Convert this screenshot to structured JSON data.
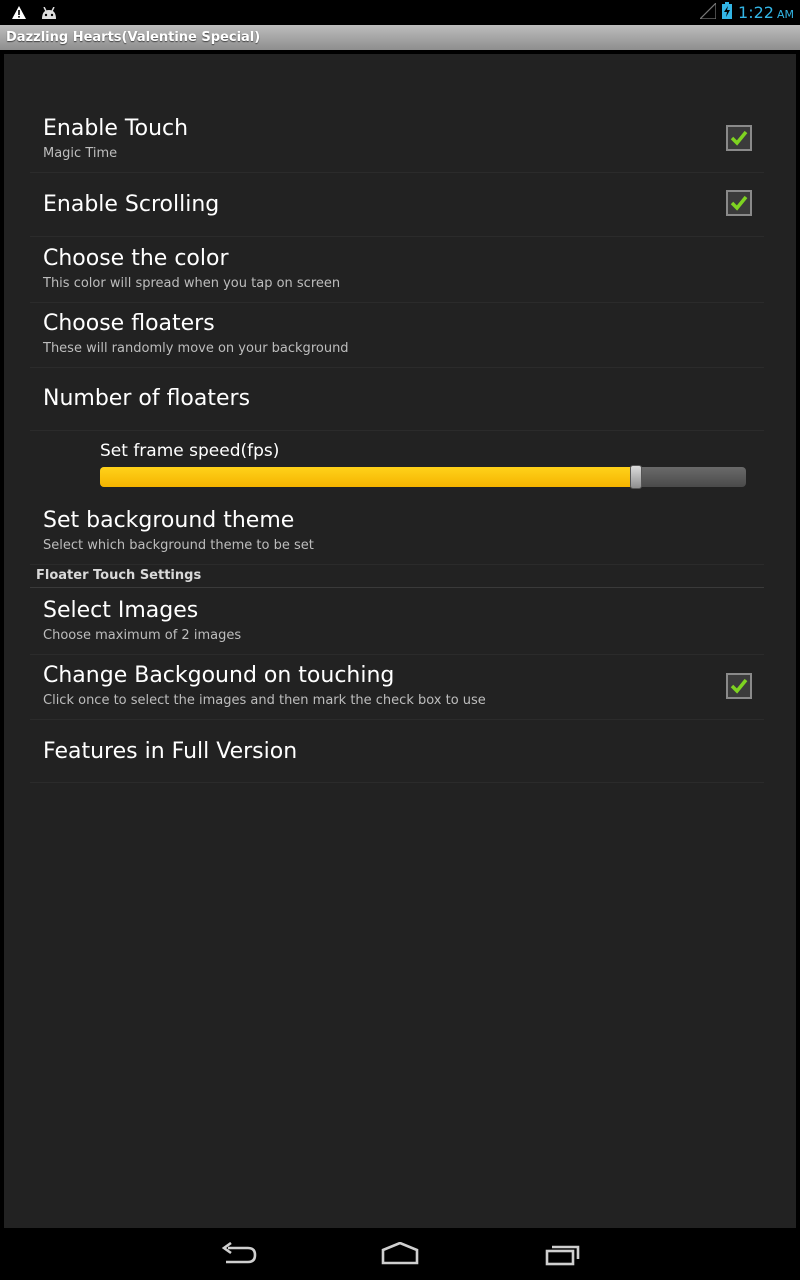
{
  "status_bar": {
    "time": "1:22",
    "ampm": "AM",
    "icons": [
      "warning-icon",
      "android-icon",
      "signal-icon",
      "battery-charging-icon"
    ]
  },
  "title_bar": {
    "title": "Dazzling Hearts(Valentine Special)"
  },
  "preferences": {
    "enable_touch": {
      "title": "Enable Touch",
      "summary": "Magic Time",
      "checked": true
    },
    "enable_scrolling": {
      "title": "Enable Scrolling",
      "checked": true
    },
    "choose_color": {
      "title": "Choose the color",
      "summary": "This color will spread when you tap on screen"
    },
    "choose_floaters": {
      "title": "Choose floaters",
      "summary": "These will randomly move on your background"
    },
    "number_of_floaters": {
      "title": "Number of floaters"
    },
    "frame_speed": {
      "label": "Set frame speed(fps)",
      "progress_fraction": 0.83
    },
    "background_theme": {
      "title": "Set background theme",
      "summary": "Select which background theme to be set"
    },
    "category_floater_touch": "Floater Touch Settings",
    "select_images": {
      "title": "Select Images",
      "summary": "Choose maximum of 2 images"
    },
    "change_background": {
      "title": "Change Backgound on touching",
      "summary": "Click once to select the images and then mark the check box to use",
      "checked": true
    },
    "full_version": {
      "title": "Features in Full Version"
    }
  },
  "colors": {
    "accent_blue": "#33b5e5",
    "seek_fill": "#f5b400",
    "check_green": "#7ed321",
    "background": "#222222"
  },
  "nav_bar": {
    "icons": [
      "back-icon",
      "home-icon",
      "recent-apps-icon"
    ]
  }
}
